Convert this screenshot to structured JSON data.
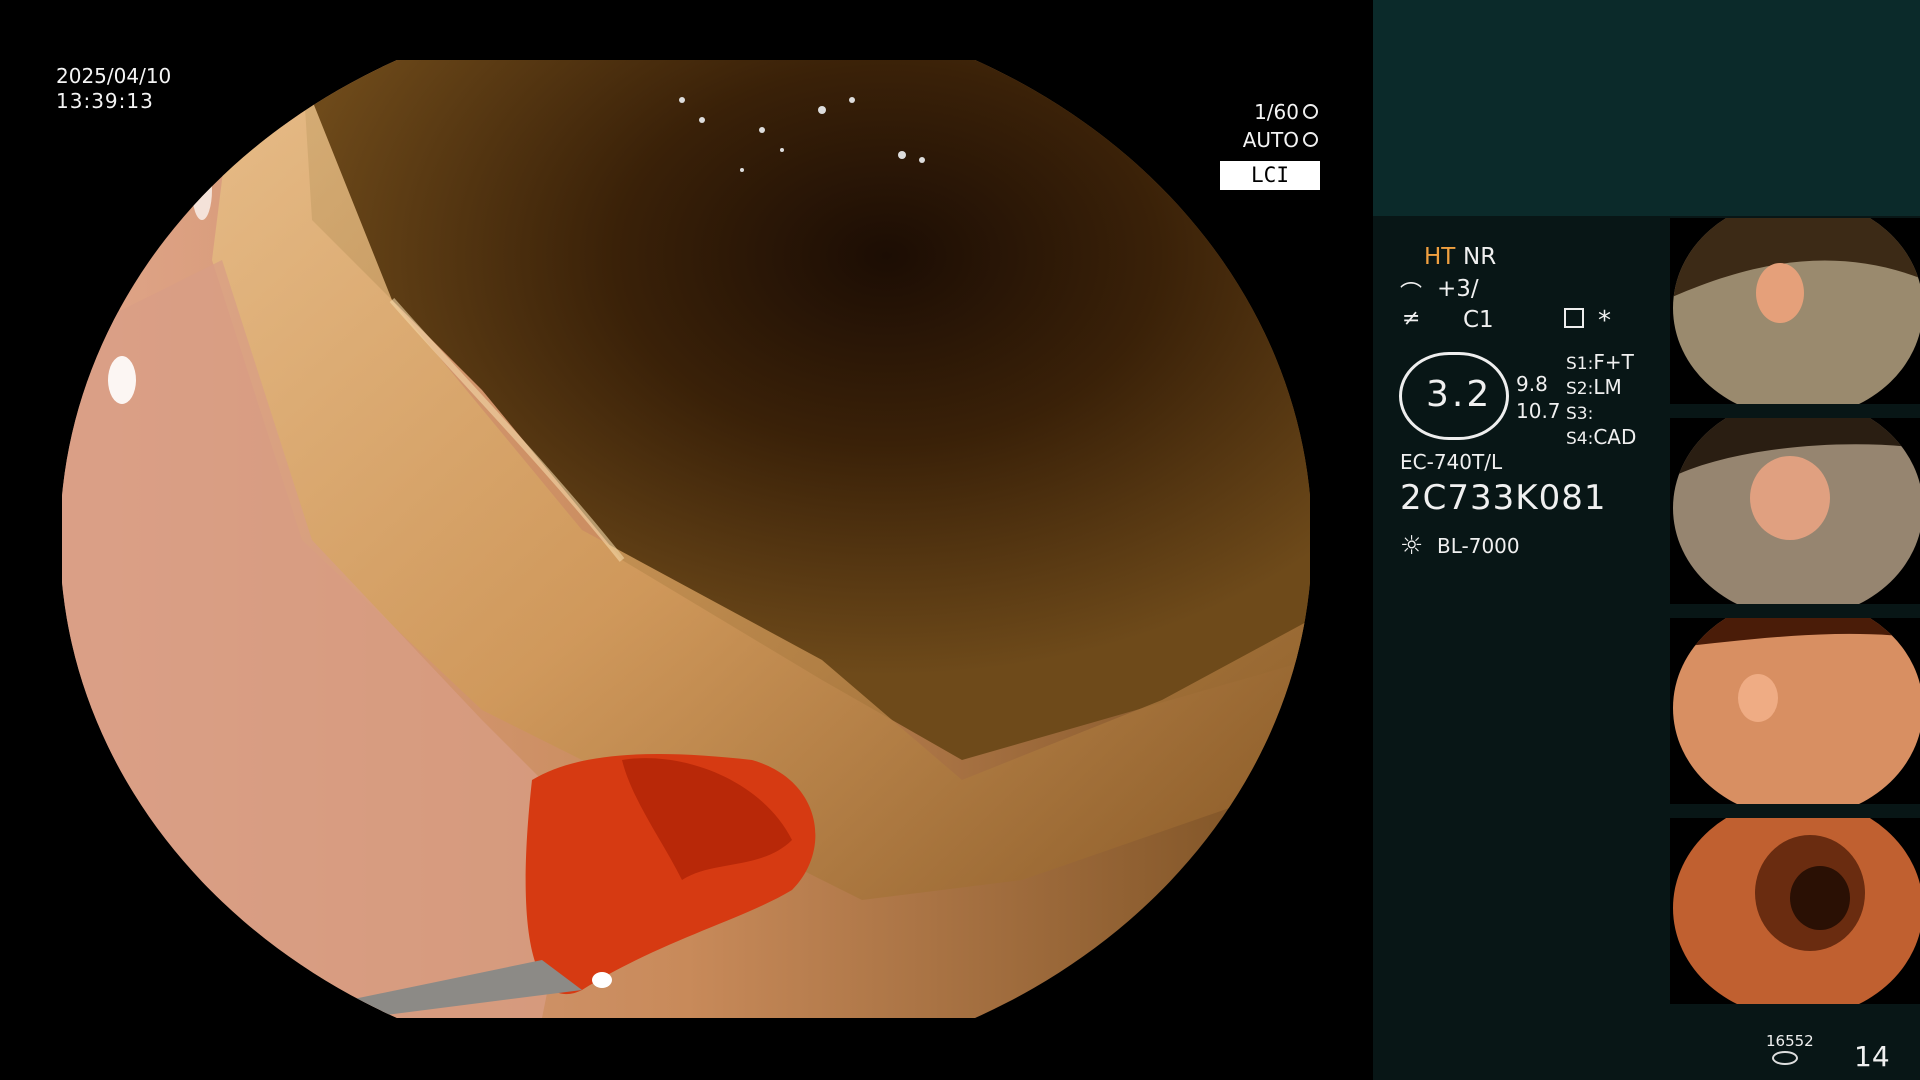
{
  "overlay": {
    "date": "2025/04/10",
    "time": "13:39:13",
    "shutter": "1/60",
    "exposure": "AUTO",
    "mode": "LCI"
  },
  "panel": {
    "ht": "HT",
    "nr": "NR",
    "enhancement": "+3/",
    "color": "C1",
    "star": "*",
    "zoom": "3.2",
    "zoom_range_1": "9.8",
    "zoom_range_2": "10.7",
    "s1": {
      "label": "S1:",
      "value": "F+T"
    },
    "s2": {
      "label": "S2:",
      "value": "LM"
    },
    "s3": {
      "label": "S3:",
      "value": ""
    },
    "s4": {
      "label": "S4:",
      "value": "CAD"
    },
    "scope_model": "EC-740T/L",
    "scope_serial": "2C733K081",
    "light_source": "BL-7000",
    "image_count": "16552",
    "page_number": "14"
  },
  "icons": {
    "shutter": "aperture-icon",
    "exposure": "iris-icon",
    "enhancement": "enhancement-icon",
    "color": "color-mode-icon",
    "keyboard": "keyboard-icon",
    "light": "sun-icon",
    "storage": "disk-icon"
  },
  "colors": {
    "panel_top": "#0b2a2a",
    "panel_side": "#081616",
    "ht_accent": "#f0a040"
  }
}
